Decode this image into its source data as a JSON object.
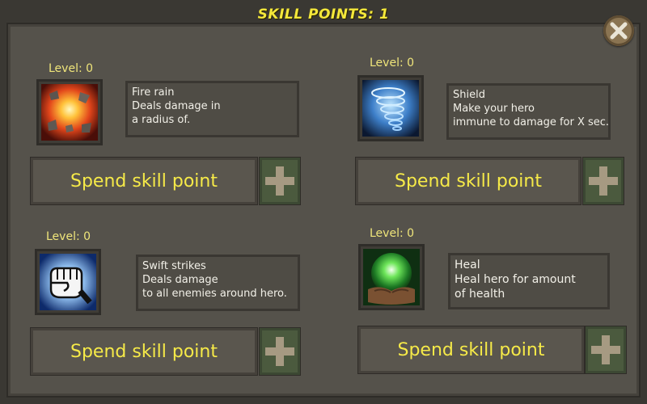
{
  "header": {
    "title": "SKILL POINTS: 1"
  },
  "close_icon": "close-icon",
  "skills": [
    {
      "id": "fire-rain",
      "level_text": "Level: 0",
      "icon": "fire-rain-icon",
      "desc_lines": [
        "Fire rain",
        "Deals  damage in",
        "a radius of."
      ],
      "spend_label": "Spend skill point"
    },
    {
      "id": "shield",
      "level_text": "Level: 0",
      "icon": "shield-tornado-icon",
      "desc_lines": [
        "Shield",
        "Make your hero",
        "immune to damage for X sec."
      ],
      "spend_label": "Spend skill point"
    },
    {
      "id": "swift-strikes",
      "level_text": "Level: 0",
      "icon": "fist-icon",
      "desc_lines": [
        "Swift strikes",
        "Deals  damage",
        "to all enemies around hero."
      ],
      "spend_label": "Spend skill point"
    },
    {
      "id": "heal",
      "level_text": "Level: 0",
      "icon": "heal-orb-icon",
      "desc_lines": [
        "Heal",
        "Heal hero for  amount",
        "of health"
      ],
      "spend_label": "Spend skill point"
    }
  ],
  "colors": {
    "title": "#f4e83a",
    "level": "#efe57a",
    "button_text": "#f6ea48",
    "panel": "#55524b"
  }
}
